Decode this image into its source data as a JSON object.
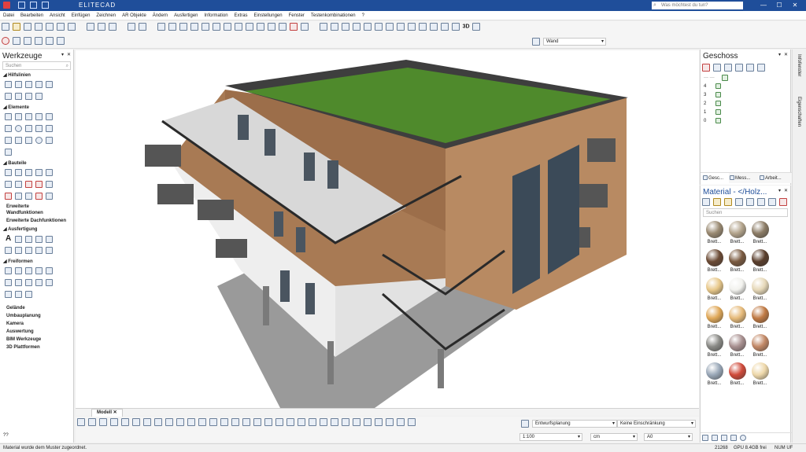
{
  "app": {
    "logo_text": "ELITECAD",
    "help_search_placeholder": "Was möchtest du tun?"
  },
  "menu": [
    "Datei",
    "Bearbeiten",
    "Ansicht",
    "Einfügen",
    "Zeichnen",
    "AR Objekte",
    "Ändern",
    "Ausfertigen",
    "Information",
    "Extras",
    "Einstellungen",
    "Fenster",
    "Testenkombinationen",
    "?"
  ],
  "toolbar": {
    "layer_dropdown_value": "Wand",
    "view_3d_label": "3D"
  },
  "werkzeuge": {
    "title": "Werkzeuge",
    "search_placeholder": "Suchen",
    "sections": {
      "hilfslinien": "Hilfslinien",
      "elemente": "Elemente",
      "bauteile": "Bauteile",
      "ausfertigung": "Ausfertigung",
      "freiformen": "Freiformen"
    },
    "links": [
      "Erweiterte Wandfunktionen",
      "Erweiterte Dachfunktionen"
    ],
    "bottom_links": [
      "Gelände",
      "Umbauplanung",
      "Kamera",
      "Auswertung",
      "BIM Werkzeuge",
      "3D Plattformen"
    ]
  },
  "geschoss": {
    "title": "Geschoss",
    "levels": [
      "4",
      "3",
      "2",
      "1",
      "0"
    ],
    "tabs": [
      "Gesc...",
      "Mess...",
      "Arbeit..."
    ]
  },
  "side_tabs": [
    "Infofenster",
    "Eigenschaften"
  ],
  "material": {
    "title": "Material - </Holz...",
    "search_placeholder": "Suchen",
    "item_label": "Brett...",
    "colors": [
      "#9a8a72",
      "#b3a48c",
      "#8c7c66",
      "#6b4a34",
      "#7a5a40",
      "#5a3e2c",
      "#e8c88a",
      "#f2f2ee",
      "#e6d8b8",
      "#e0a858",
      "#e6ba7a",
      "#c07a44",
      "#8a8a86",
      "#a89090",
      "#c28866",
      "#9aa8b8",
      "#d04a3a",
      "#eed8aa"
    ]
  },
  "viewport": {
    "tab_label": "Modell"
  },
  "bottom_bar": {
    "planning_dropdown": "Entwurfsplanung",
    "restriction_dropdown": "Keine Einschränkung",
    "scale_value": "1:100",
    "unit_value": "cm",
    "paper_value": "A0",
    "command_prompt": "??"
  },
  "status": {
    "message": "Material wurde dem Muster zugeordnet.",
    "coordinate": "21268",
    "gpu": "GPU 8.4GB frei",
    "mode": "NUM UF"
  }
}
